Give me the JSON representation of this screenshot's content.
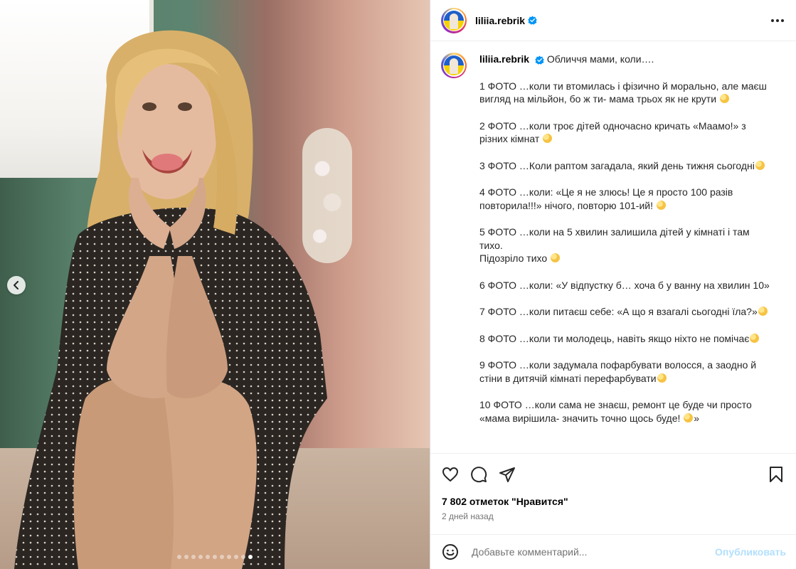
{
  "post": {
    "username": "liliia.rebrik",
    "verified": true,
    "photo": {
      "slide_count": 11,
      "active_slide": 11
    },
    "caption": {
      "title": "Обличчя мами, коли….",
      "paragraphs": [
        "1 ФОТО …коли ти втомилась і фізично й морально, але маєш вигляд на мільйон, бо ж ти- мама трьох як не крути",
        "2 ФОТО …коли троє дітей одночасно кричать «Маамо!» з різних кімнат",
        "3 ФОТО …Коли раптом загадала, який день тижня сьогодні",
        "4 ФОТО …коли: «Це я не злюсь! Це я просто 100 разів повторила!!!» нічого, повторю 101-ий!",
        "5 ФОТО …коли на 5 хвилин залишила дітей у кімнаті і там тихо.\nПідозріло тихо",
        "6 ФОТО …коли: «У відпустку б… хоча б у ванну на хвилин 10»",
        "7 ФОТО …коли питаєш себе: «А що я взагалі сьогодні їла?»",
        "8 ФОТО …коли ти молодець, навіть якщо ніхто не помічає",
        "9 ФОТО …коли задумала пофарбувати волосся, а заодно й стіни в дитячій кімнаті перефарбувати",
        "10 ФОТО …коли сама не знаєш, ремонт це буде чи просто «мама вирішила- значить точно щось буде!"
      ]
    },
    "likes_text": "7 802 отметок \"Нравится\"",
    "time_ago": "2 дней назад"
  },
  "comment": {
    "placeholder": "Добавьте комментарий...",
    "post_label": "Опубликовать"
  },
  "icons": {
    "like": "heart-icon",
    "comment": "comment-icon",
    "share": "send-icon",
    "save": "bookmark-icon",
    "more": "more-horizontal-icon",
    "emoji": "emoji-icon",
    "prev": "chevron-left-icon"
  },
  "colors": {
    "verified": "#0095f6",
    "post_button_disabled": "#b2dffc",
    "secondary_text": "#737373"
  }
}
